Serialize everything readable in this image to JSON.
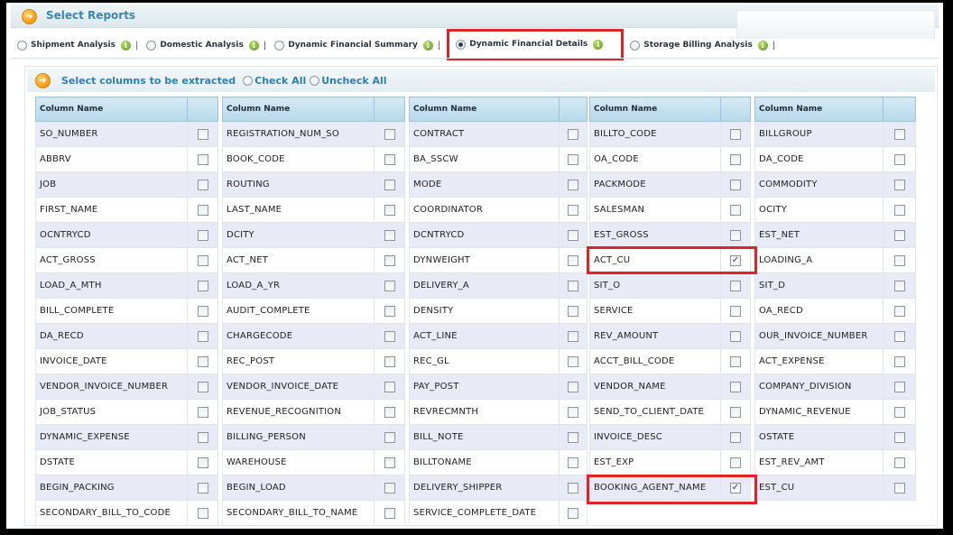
{
  "header": {
    "title": "Select Reports"
  },
  "tabs": [
    {
      "label": "Shipment Analysis",
      "selected": false
    },
    {
      "label": "Domestic Analysis",
      "selected": false
    },
    {
      "label": "Dynamic Financial Summary",
      "selected": false
    },
    {
      "label": "Dynamic Financial Details",
      "selected": true
    },
    {
      "label": "Storage Billing Analysis",
      "selected": false
    }
  ],
  "columns_bar": {
    "label": "Select columns to be extracted",
    "check_all": "Check All",
    "uncheck_all": "Uncheck All"
  },
  "column_header": "Column Name",
  "groups": [
    {
      "rows": [
        {
          "name": "SO_NUMBER",
          "checked": false
        },
        {
          "name": "ABBRV",
          "checked": false
        },
        {
          "name": "JOB",
          "checked": false
        },
        {
          "name": "FIRST_NAME",
          "checked": false
        },
        {
          "name": "OCNTRYCD",
          "checked": false
        },
        {
          "name": "ACT_GROSS",
          "checked": false
        },
        {
          "name": "LOAD_A_MTH",
          "checked": false
        },
        {
          "name": "BILL_COMPLETE",
          "checked": false
        },
        {
          "name": "DA_RECD",
          "checked": false
        },
        {
          "name": "INVOICE_DATE",
          "checked": false
        },
        {
          "name": "VENDOR_INVOICE_NUMBER",
          "checked": false
        },
        {
          "name": "JOB_STATUS",
          "checked": false
        },
        {
          "name": "DYNAMIC_EXPENSE",
          "checked": false
        },
        {
          "name": "DSTATE",
          "checked": false
        },
        {
          "name": "BEGIN_PACKING",
          "checked": false
        },
        {
          "name": "SECONDARY_BILL_TO_CODE",
          "checked": false
        }
      ]
    },
    {
      "rows": [
        {
          "name": "REGISTRATION_NUM_SO",
          "checked": false
        },
        {
          "name": "BOOK_CODE",
          "checked": false
        },
        {
          "name": "ROUTING",
          "checked": false
        },
        {
          "name": "LAST_NAME",
          "checked": false
        },
        {
          "name": "DCITY",
          "checked": false
        },
        {
          "name": "ACT_NET",
          "checked": false
        },
        {
          "name": "LOAD_A_YR",
          "checked": false
        },
        {
          "name": "AUDIT_COMPLETE",
          "checked": false
        },
        {
          "name": "CHARGECODE",
          "checked": false
        },
        {
          "name": "REC_POST",
          "checked": false
        },
        {
          "name": "VENDOR_INVOICE_DATE",
          "checked": false
        },
        {
          "name": "REVENUE_RECOGNITION",
          "checked": false
        },
        {
          "name": "BILLING_PERSON",
          "checked": false
        },
        {
          "name": "WAREHOUSE",
          "checked": false
        },
        {
          "name": "BEGIN_LOAD",
          "checked": false
        },
        {
          "name": "SECONDARY_BILL_TO_NAME",
          "checked": false
        }
      ]
    },
    {
      "rows": [
        {
          "name": "CONTRACT",
          "checked": false
        },
        {
          "name": "BA_SSCW",
          "checked": false
        },
        {
          "name": "MODE",
          "checked": false
        },
        {
          "name": "COORDINATOR",
          "checked": false
        },
        {
          "name": "DCNTRYCD",
          "checked": false
        },
        {
          "name": "DYNWEIGHT",
          "checked": false
        },
        {
          "name": "DELIVERY_A",
          "checked": false
        },
        {
          "name": "DENSITY",
          "checked": false
        },
        {
          "name": "ACT_LINE",
          "checked": false
        },
        {
          "name": "REC_GL",
          "checked": false
        },
        {
          "name": "PAY_POST",
          "checked": false
        },
        {
          "name": "REVRECMNTH",
          "checked": false
        },
        {
          "name": "BILL_NOTE",
          "checked": false
        },
        {
          "name": "BILLTONAME",
          "checked": false
        },
        {
          "name": "DELIVERY_SHIPPER",
          "checked": false
        },
        {
          "name": "SERVICE_COMPLETE_DATE",
          "checked": false
        }
      ]
    },
    {
      "rows": [
        {
          "name": "BILLTO_CODE",
          "checked": false
        },
        {
          "name": "OA_CODE",
          "checked": false
        },
        {
          "name": "PACKMODE",
          "checked": false
        },
        {
          "name": "SALESMAN",
          "checked": false
        },
        {
          "name": "EST_GROSS",
          "checked": false
        },
        {
          "name": "ACT_CU",
          "checked": true
        },
        {
          "name": "SIT_O",
          "checked": false
        },
        {
          "name": "SERVICE",
          "checked": false
        },
        {
          "name": "REV_AMOUNT",
          "checked": false
        },
        {
          "name": "ACCT_BILL_CODE",
          "checked": false
        },
        {
          "name": "VENDOR_NAME",
          "checked": false
        },
        {
          "name": "SEND_TO_CLIENT_DATE",
          "checked": false
        },
        {
          "name": "INVOICE_DESC",
          "checked": false
        },
        {
          "name": "EST_EXP",
          "checked": false
        },
        {
          "name": "BOOKING_AGENT_NAME",
          "checked": true
        }
      ]
    },
    {
      "rows": [
        {
          "name": "BILLGROUP",
          "checked": false
        },
        {
          "name": "DA_CODE",
          "checked": false
        },
        {
          "name": "COMMODITY",
          "checked": false
        },
        {
          "name": "OCITY",
          "checked": false
        },
        {
          "name": "EST_NET",
          "checked": false
        },
        {
          "name": "LOADING_A",
          "checked": false
        },
        {
          "name": "SIT_D",
          "checked": false
        },
        {
          "name": "OA_RECD",
          "checked": false
        },
        {
          "name": "OUR_INVOICE_NUMBER",
          "checked": false
        },
        {
          "name": "ACT_EXPENSE",
          "checked": false
        },
        {
          "name": "COMPANY_DIVISION",
          "checked": false
        },
        {
          "name": "DYNAMIC_REVENUE",
          "checked": false
        },
        {
          "name": "OSTATE",
          "checked": false
        },
        {
          "name": "EST_REV_AMT",
          "checked": false
        },
        {
          "name": "EST_CU",
          "checked": false
        }
      ]
    }
  ],
  "colors": {
    "highlight": "#e12228",
    "accent": "#2f7fb0",
    "row_alt": "#e8ebf5"
  }
}
